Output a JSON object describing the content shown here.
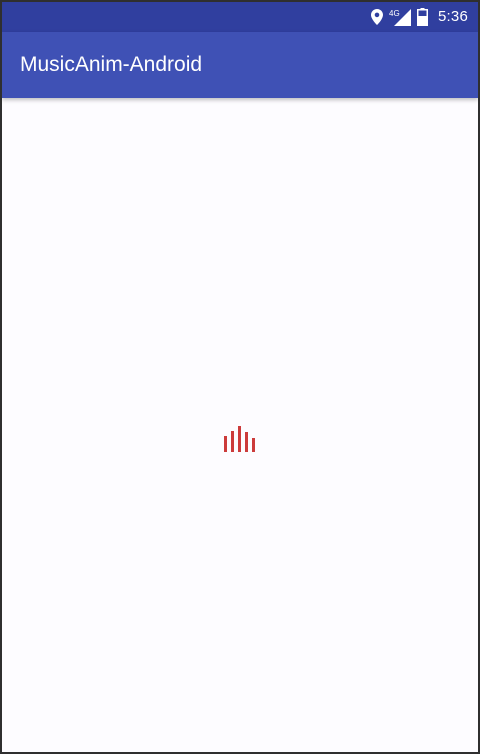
{
  "status_bar": {
    "time": "5:36",
    "network": "4G",
    "icons": [
      "location-icon",
      "signal-icon",
      "battery-icon"
    ],
    "background_color": "#303f9f"
  },
  "app_bar": {
    "title": "MusicAnim-Android",
    "background_color": "#3f51b5"
  },
  "music_animation": {
    "color": "#cc3b3b",
    "icon": "music-bars-icon"
  }
}
